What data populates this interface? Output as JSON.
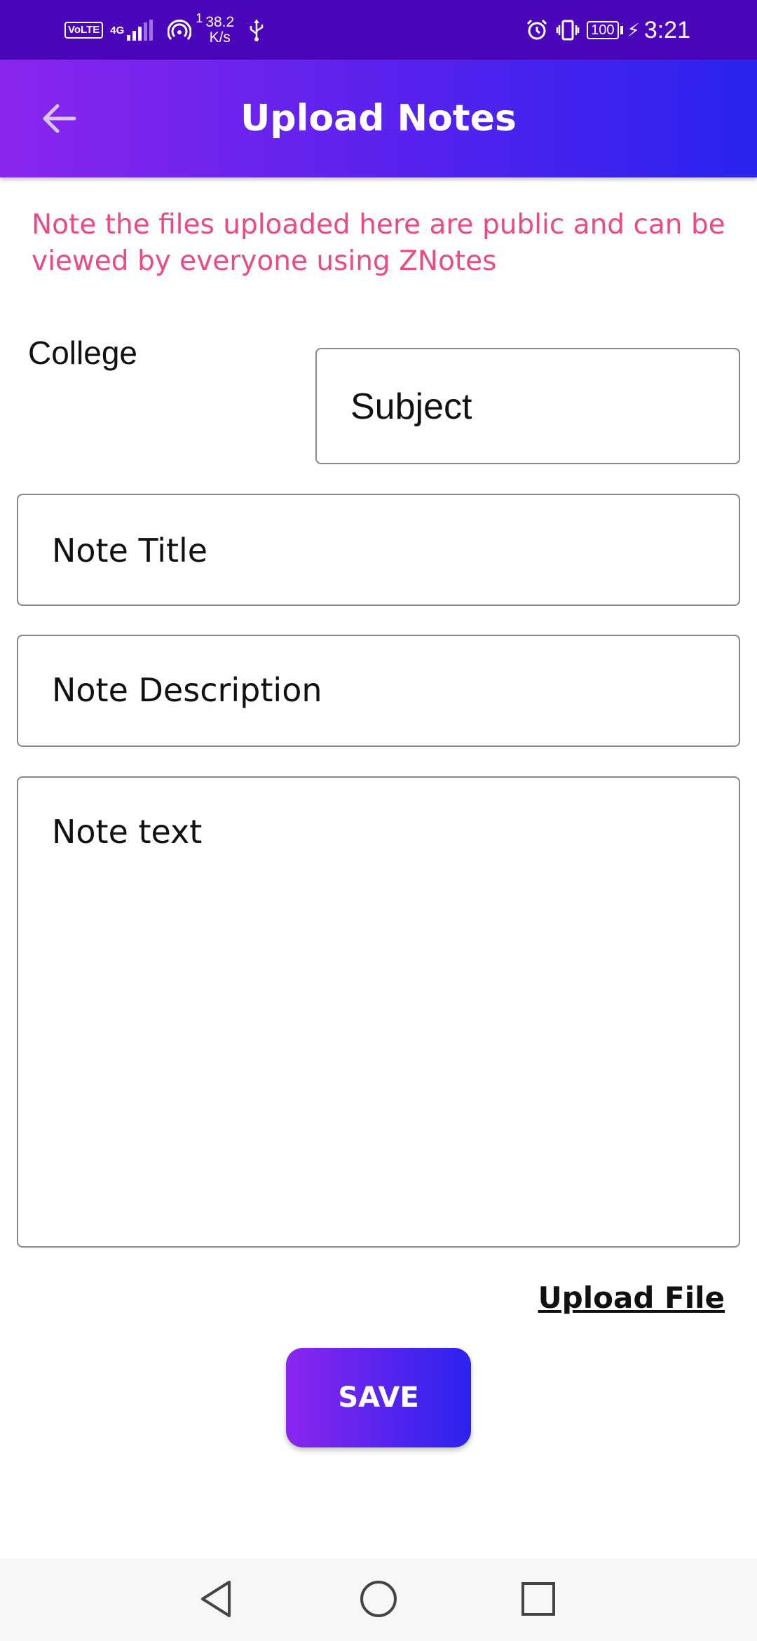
{
  "status_bar": {
    "volte": "VoLTE",
    "network": "4G",
    "hotspot_count": "1",
    "speed_value": "38.2",
    "speed_unit": "K/s",
    "battery": "100",
    "time": "3:21",
    "icons": [
      "signal-icon",
      "hotspot-icon",
      "usb-icon",
      "alarm-icon",
      "vibrate-icon",
      "battery-icon",
      "charging-icon"
    ]
  },
  "app_bar": {
    "title": "Upload Notes",
    "back_icon": "arrow-left-icon"
  },
  "notice": "Note the files uploaded here are public and can be viewed by everyone using ZNotes",
  "form": {
    "college_label": "College",
    "subject_placeholder": "Subject",
    "note_title_placeholder": "Note Title",
    "note_description_placeholder": "Note Description",
    "note_text_placeholder": "Note text",
    "upload_file_label": "Upload File",
    "save_label": "SAVE"
  },
  "nav_bar": {
    "icons": [
      "back-triangle-icon",
      "home-circle-icon",
      "recents-square-icon"
    ]
  },
  "colors": {
    "status_bar": "#4a06b8",
    "app_bar_start": "#8a26ee",
    "app_bar_end": "#2a23ee",
    "notice_text": "#ec4a86"
  }
}
